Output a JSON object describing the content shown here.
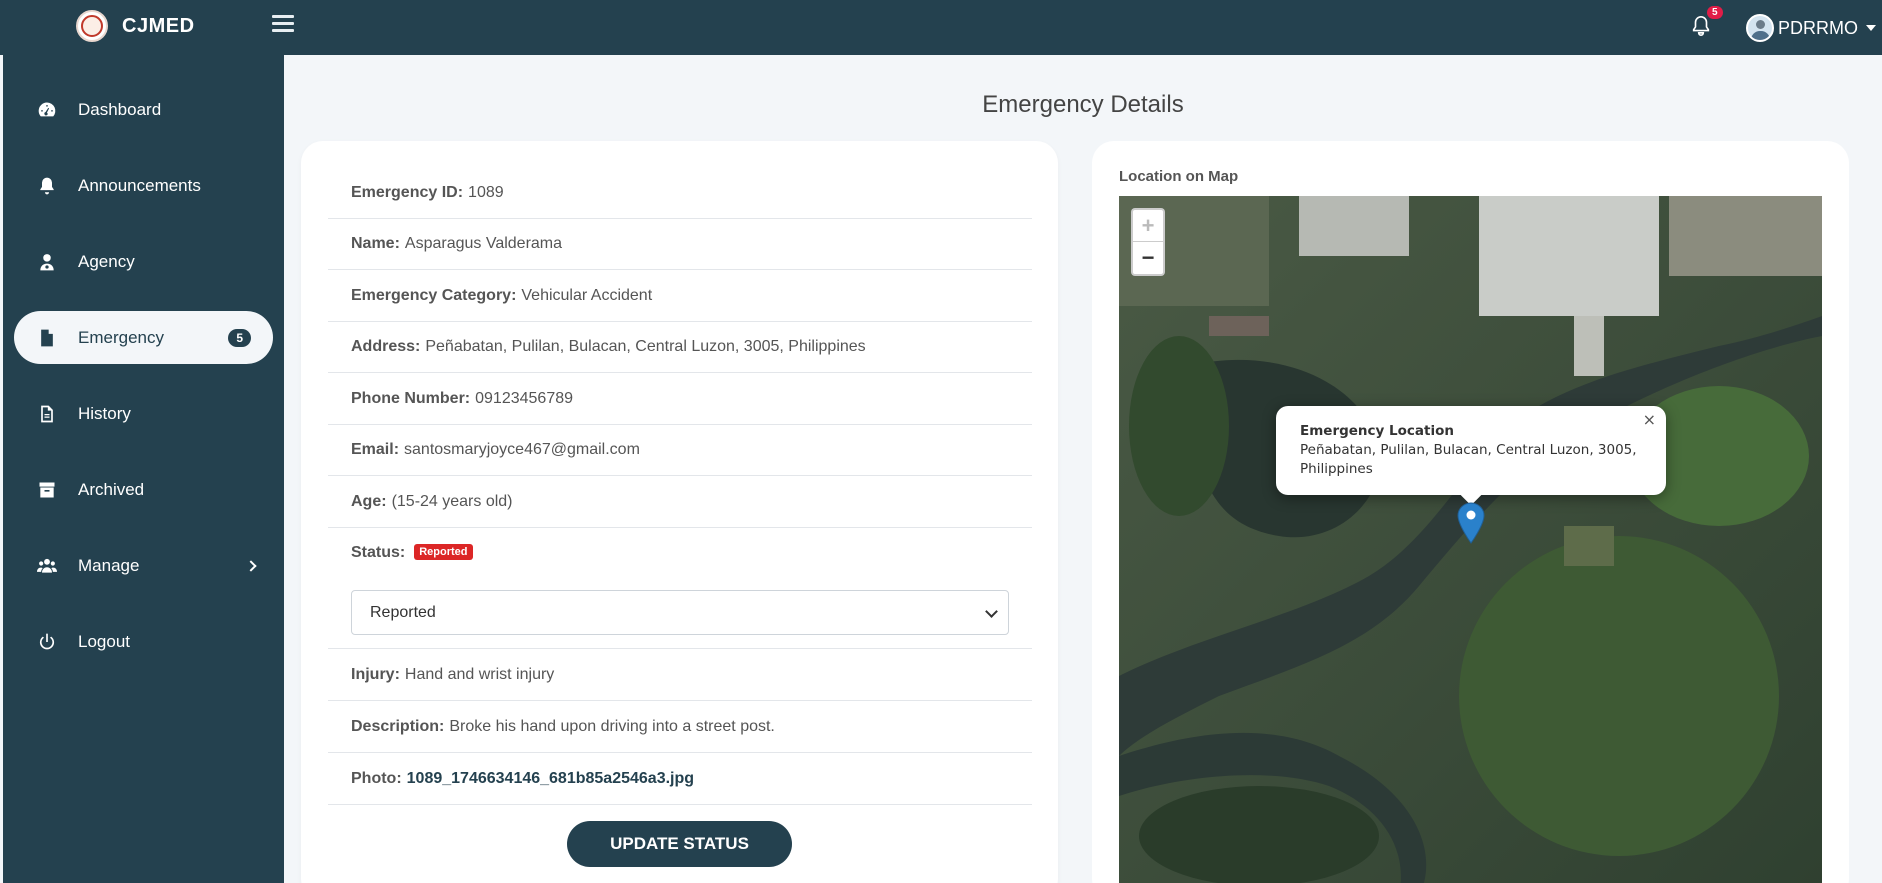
{
  "brand": {
    "name": "CJMED"
  },
  "header": {
    "notification_count": "5",
    "user_name": "PDRRMO",
    "icons": {
      "menu": "hamburger-icon",
      "bell": "bell-icon",
      "avatar": "user-avatar",
      "dropdown": "caret-down-icon"
    }
  },
  "sidebar": {
    "items": [
      {
        "label": "Dashboard",
        "icon": "tachometer-icon"
      },
      {
        "label": "Announcements",
        "icon": "bell-icon"
      },
      {
        "label": "Agency",
        "icon": "user-doctor-icon"
      },
      {
        "label": "Emergency",
        "icon": "file-icon",
        "badge": "5",
        "active": true
      },
      {
        "label": "History",
        "icon": "file-lines-icon"
      },
      {
        "label": "Archived",
        "icon": "archive-icon"
      },
      {
        "label": "Manage",
        "icon": "users-icon"
      },
      {
        "label": "Logout",
        "icon": "power-icon"
      }
    ]
  },
  "page": {
    "title": "Emergency Details"
  },
  "details": {
    "id": {
      "label": "Emergency ID:",
      "value": "1089"
    },
    "name": {
      "label": "Name:",
      "value": "Asparagus Valderama"
    },
    "category": {
      "label": "Emergency Category:",
      "value": "Vehicular Accident"
    },
    "address": {
      "label": "Address:",
      "value": "Peñabatan, Pulilan, Bulacan, Central Luzon, 3005, Philippines"
    },
    "phone": {
      "label": "Phone Number:",
      "value": "09123456789"
    },
    "email": {
      "label": "Email:",
      "value": "santosmaryjoyce467@gmail.com"
    },
    "age": {
      "label": "Age:",
      "value": "(15-24 years old)"
    },
    "status": {
      "label": "Status:",
      "badge": "Reported",
      "select_value": "Reported"
    },
    "injury": {
      "label": "Injury:",
      "value": "Hand and wrist injury"
    },
    "description": {
      "label": "Description:",
      "value": "Broke his hand upon driving into a street post."
    },
    "photo": {
      "label": "Photo:",
      "value": "1089_1746634146_681b85a2546a3.jpg"
    },
    "update_button": "UPDATE STATUS"
  },
  "map": {
    "label": "Location on Map",
    "zoom_in": "+",
    "zoom_out": "−",
    "popup_title": "Emergency Location",
    "popup_text": "Peñabatan, Pulilan, Bulacan, Central Luzon, 3005, Philippines",
    "popup_close": "×",
    "colors": {
      "marker": "#2a81cb",
      "badge": "#dc2626",
      "primary": "#24414f"
    }
  }
}
